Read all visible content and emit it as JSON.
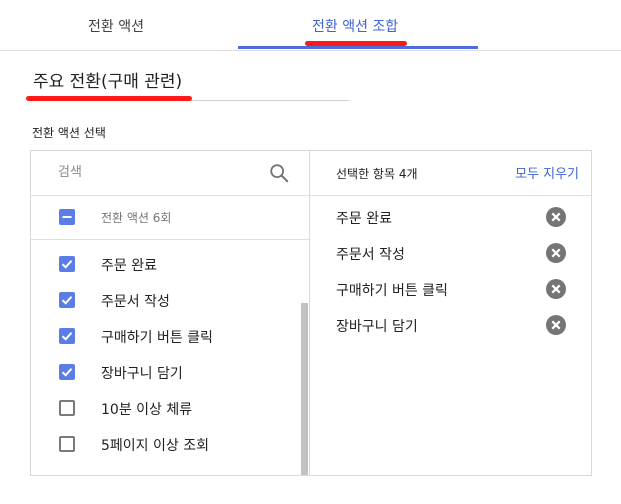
{
  "tabs": [
    {
      "label": "전환 액션",
      "active": false
    },
    {
      "label": "전환 액션 조합",
      "active": true
    }
  ],
  "colors": {
    "accent": "#4a6fdc",
    "link": "#3f63d6",
    "checkbox": "#5b7ee6",
    "annotation": "#ff1a1a"
  },
  "name_field": {
    "value": "주요 전환(구매 관련)"
  },
  "section": {
    "label": "전환 액션 선택"
  },
  "search": {
    "placeholder": "검색",
    "icon": "search-icon"
  },
  "select_all": {
    "label": "전환 액션 6회",
    "state": "indeterminate"
  },
  "items": [
    {
      "label": "주문 완료",
      "checked": true
    },
    {
      "label": "주문서 작성",
      "checked": true
    },
    {
      "label": "구매하기 버튼 클릭",
      "checked": true
    },
    {
      "label": "장바구니 담기",
      "checked": true
    },
    {
      "label": "10분 이상 체류",
      "checked": false
    },
    {
      "label": "5페이지 이상 조회",
      "checked": false
    }
  ],
  "selected": {
    "count_label": "선택한 항목 4개",
    "clear_label": "모두 지우기",
    "items": [
      "주문 완료",
      "주문서 작성",
      "구매하기 버튼 클릭",
      "장바구니 담기"
    ]
  }
}
